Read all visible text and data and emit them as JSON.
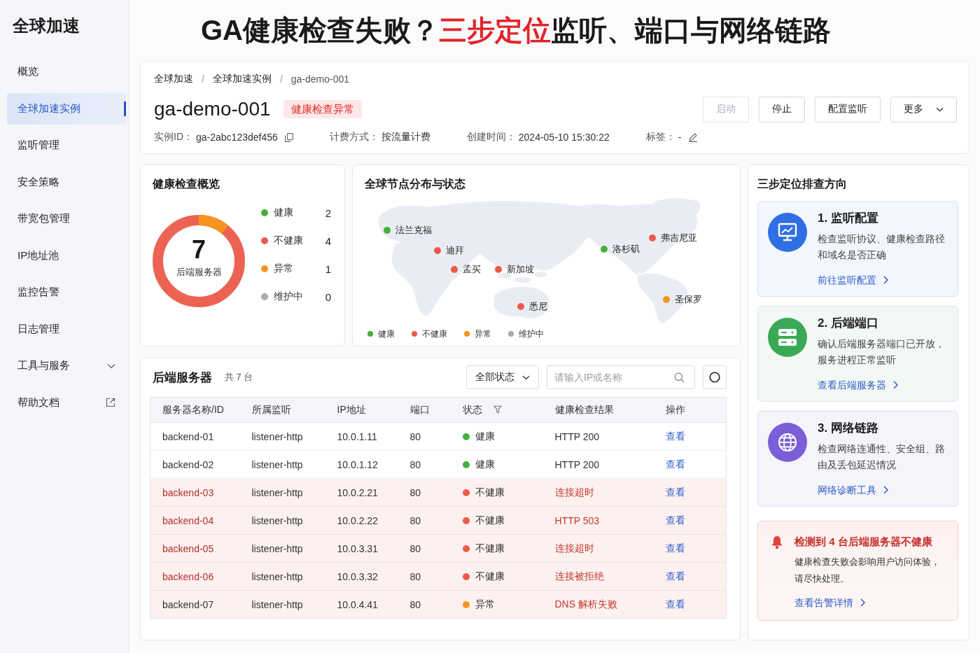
{
  "sidebar": {
    "title": "全球加速",
    "items": [
      {
        "label": "概览",
        "selected": false,
        "kind": "link"
      },
      {
        "label": "全球加速实例",
        "selected": true,
        "kind": "link"
      },
      {
        "label": "监听管理",
        "selected": false,
        "kind": "link"
      },
      {
        "label": "安全策略",
        "selected": false,
        "kind": "link"
      },
      {
        "label": "带宽包管理",
        "selected": false,
        "kind": "link"
      },
      {
        "label": "IP地址池",
        "selected": false,
        "kind": "link"
      },
      {
        "label": "监控告警",
        "selected": false,
        "kind": "link"
      },
      {
        "label": "日志管理",
        "selected": false,
        "kind": "link"
      },
      {
        "label": "工具与服务",
        "selected": false,
        "kind": "expandable"
      },
      {
        "label": "帮助文档",
        "selected": false,
        "kind": "external"
      }
    ]
  },
  "headline": {
    "parts": [
      {
        "text": "GA健康检查失败？",
        "highlight": false
      },
      {
        "text": "三步定位",
        "highlight": true
      },
      {
        "text": "监听、端口与网络链路",
        "highlight": false
      }
    ]
  },
  "instance": {
    "breadcrumb": {
      "separator": "/",
      "items": [
        {
          "label": "全球加速",
          "current": false
        },
        {
          "label": "全球加速实例",
          "current": false
        },
        {
          "label": "ga-demo-001",
          "current": true
        }
      ]
    },
    "name": "ga-demo-001",
    "status_badge": "健康检查异常",
    "buttons": [
      {
        "label": "启动",
        "disabled": true,
        "kind": "plain"
      },
      {
        "label": "停止",
        "disabled": false,
        "kind": "plain"
      },
      {
        "label": "配置监听",
        "disabled": false,
        "kind": "plain"
      },
      {
        "label": "更多",
        "disabled": false,
        "kind": "dropdown"
      }
    ],
    "meta": {
      "instance_id": {
        "label": "实例ID：",
        "value": "ga-2abc123def456"
      },
      "billing": {
        "label": "计费方式：",
        "value": "按流量计费"
      },
      "created": {
        "label": "创建时间：",
        "value": "2024-05-10 15:30:22"
      },
      "tags": {
        "label": "标签：",
        "value": "-"
      }
    }
  },
  "health": {
    "title": "健康检查概览",
    "total": "7",
    "total_label": "后端服务器",
    "legend": [
      {
        "label": "健康",
        "count": "2",
        "color": "#45b03e"
      },
      {
        "label": "不健康",
        "count": "4",
        "color": "#ee5a4a"
      },
      {
        "label": "异常",
        "count": "1",
        "color": "#f7941d"
      },
      {
        "label": "维护中",
        "count": "0",
        "color": "#a9abae"
      }
    ]
  },
  "map": {
    "title": "全球节点分布与状态",
    "nodes": [
      {
        "name": "法兰克福",
        "color": "#45b03e"
      },
      {
        "name": "迪拜",
        "color": "#ee5a4a"
      },
      {
        "name": "孟买",
        "color": "#ee5a4a"
      },
      {
        "name": "新加坡",
        "color": "#ee5a4a"
      },
      {
        "name": "悉尼",
        "color": "#ee5a4a"
      },
      {
        "name": "洛杉矶",
        "color": "#45b03e"
      },
      {
        "name": "弗吉尼亚",
        "color": "#ee5a4a"
      },
      {
        "name": "圣保罗",
        "color": "#f7941d"
      }
    ],
    "legend": [
      {
        "label": "健康",
        "color": "#45b03e"
      },
      {
        "label": "不健康",
        "color": "#ee5a4a"
      },
      {
        "label": "异常",
        "color": "#f7941d"
      },
      {
        "label": "维护中",
        "color": "#a9abae"
      }
    ]
  },
  "troubleshooting": {
    "title": "三步定位排查方向",
    "steps": [
      {
        "kind": "listener",
        "title": "1. 监听配置",
        "description": "检查监听协议、健康检查路径和域名是否正确",
        "link": "前往监听配置"
      },
      {
        "kind": "port",
        "title": "2. 后端端口",
        "description": "确认后端服务器端口已开放，服务进程正常监听",
        "link": "查看后端服务器"
      },
      {
        "kind": "network",
        "title": "3. 网络链路",
        "description": "检查网络连通性、安全组、路由及丢包延迟情况",
        "link": "网络诊断工具"
      }
    ],
    "alert": {
      "title": "检测到 4 台后端服务器不健康",
      "description": "健康检查失败会影响用户访问体验，请尽快处理。",
      "link": "查看告警详情"
    }
  },
  "backends": {
    "title": "后端服务器",
    "count": "共 7 台",
    "filter": {
      "value": "全部状态"
    },
    "search": {
      "placeholder": "请输入IP或名称"
    },
    "columns": [
      {
        "label": "服务器名称/ID",
        "filterable": false
      },
      {
        "label": "所属监听",
        "filterable": false
      },
      {
        "label": "IP地址",
        "filterable": false
      },
      {
        "label": "端口",
        "filterable": false
      },
      {
        "label": "状态",
        "filterable": true
      },
      {
        "label": "健康检查结果",
        "filterable": false
      },
      {
        "label": "操作",
        "filterable": false
      }
    ],
    "rows": [
      {
        "kind": "healthy",
        "name": "backend-01",
        "listener": "listener-http",
        "ip": "10.0.1.11",
        "port": "80",
        "status": {
          "label": "健康",
          "color": "#45b03e"
        },
        "result": "HTTP 200",
        "action": "查看"
      },
      {
        "kind": "healthy",
        "name": "backend-02",
        "listener": "listener-http",
        "ip": "10.0.1.12",
        "port": "80",
        "status": {
          "label": "健康",
          "color": "#45b03e"
        },
        "result": "HTTP 200",
        "action": "查看"
      },
      {
        "kind": "unhealthy",
        "name": "backend-03",
        "listener": "listener-http",
        "ip": "10.0.2.21",
        "port": "80",
        "status": {
          "label": "不健康",
          "color": "#ee5a4a"
        },
        "result": "连接超时",
        "action": "查看"
      },
      {
        "kind": "unhealthy",
        "name": "backend-04",
        "listener": "listener-http",
        "ip": "10.0.2.22",
        "port": "80",
        "status": {
          "label": "不健康",
          "color": "#ee5a4a"
        },
        "result": "HTTP 503",
        "action": "查看"
      },
      {
        "kind": "unhealthy",
        "name": "backend-05",
        "listener": "listener-http",
        "ip": "10.0.3.31",
        "port": "80",
        "status": {
          "label": "不健康",
          "color": "#ee5a4a"
        },
        "result": "连接超时",
        "action": "查看"
      },
      {
        "kind": "unhealthy",
        "name": "backend-06",
        "listener": "listener-http",
        "ip": "10.0.3.32",
        "port": "80",
        "status": {
          "label": "不健康",
          "color": "#ee5a4a"
        },
        "result": "连接被拒绝",
        "action": "查看"
      },
      {
        "kind": "abnormal",
        "name": "backend-07",
        "listener": "listener-http",
        "ip": "10.0.4.41",
        "port": "80",
        "status": {
          "label": "异常",
          "color": "#f7941d"
        },
        "result": "DNS 解析失败",
        "action": "查看"
      }
    ]
  }
}
